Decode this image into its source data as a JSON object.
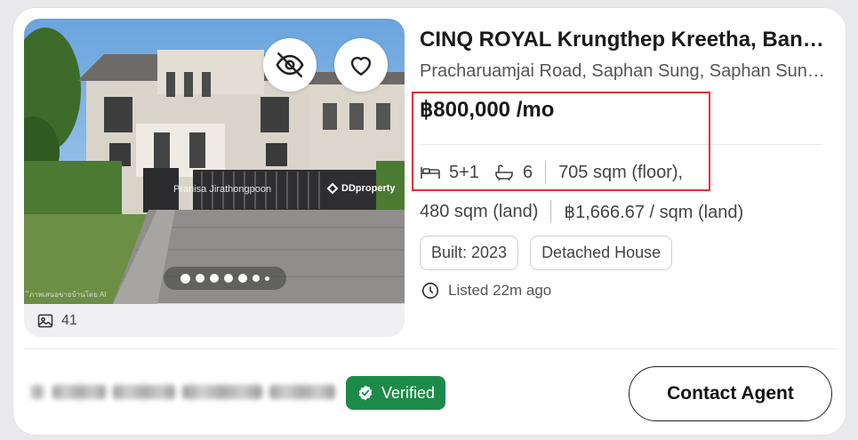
{
  "listing": {
    "title": "CINQ ROYAL Krungthep Kreetha, Bangkok",
    "address": "Pracharuamjai Road, Saphan Sung, Saphan Sung, Bangkok",
    "price": "฿800,000 /mo",
    "bedrooms": "5+1",
    "bathrooms": "6",
    "floor_area": "705 sqm (floor),",
    "land_area": "480 sqm (land)",
    "price_per_land": "฿1,666.67 / sqm (land)",
    "tags": [
      "Built: 2023",
      "Detached House"
    ],
    "listed": "Listed 22m ago"
  },
  "gallery": {
    "photo_count": "41",
    "watermark_name": "Pranisa Jirathongpoon",
    "watermark_brand": "DDproperty",
    "watermark_corner": "ิภาพเสนอขายบ้านโดย AI",
    "dots_total": 7,
    "active_dot": 1
  },
  "footer": {
    "verified_label": "Verified",
    "contact_label": "Contact Agent"
  },
  "colors": {
    "verified_bg": "#1e8a4a",
    "highlight_border": "#e5303a"
  },
  "icons": [
    "eye-off-icon",
    "heart-icon",
    "image-icon",
    "bed-icon",
    "bathtub-icon",
    "clock-icon",
    "shield-check-icon"
  ]
}
